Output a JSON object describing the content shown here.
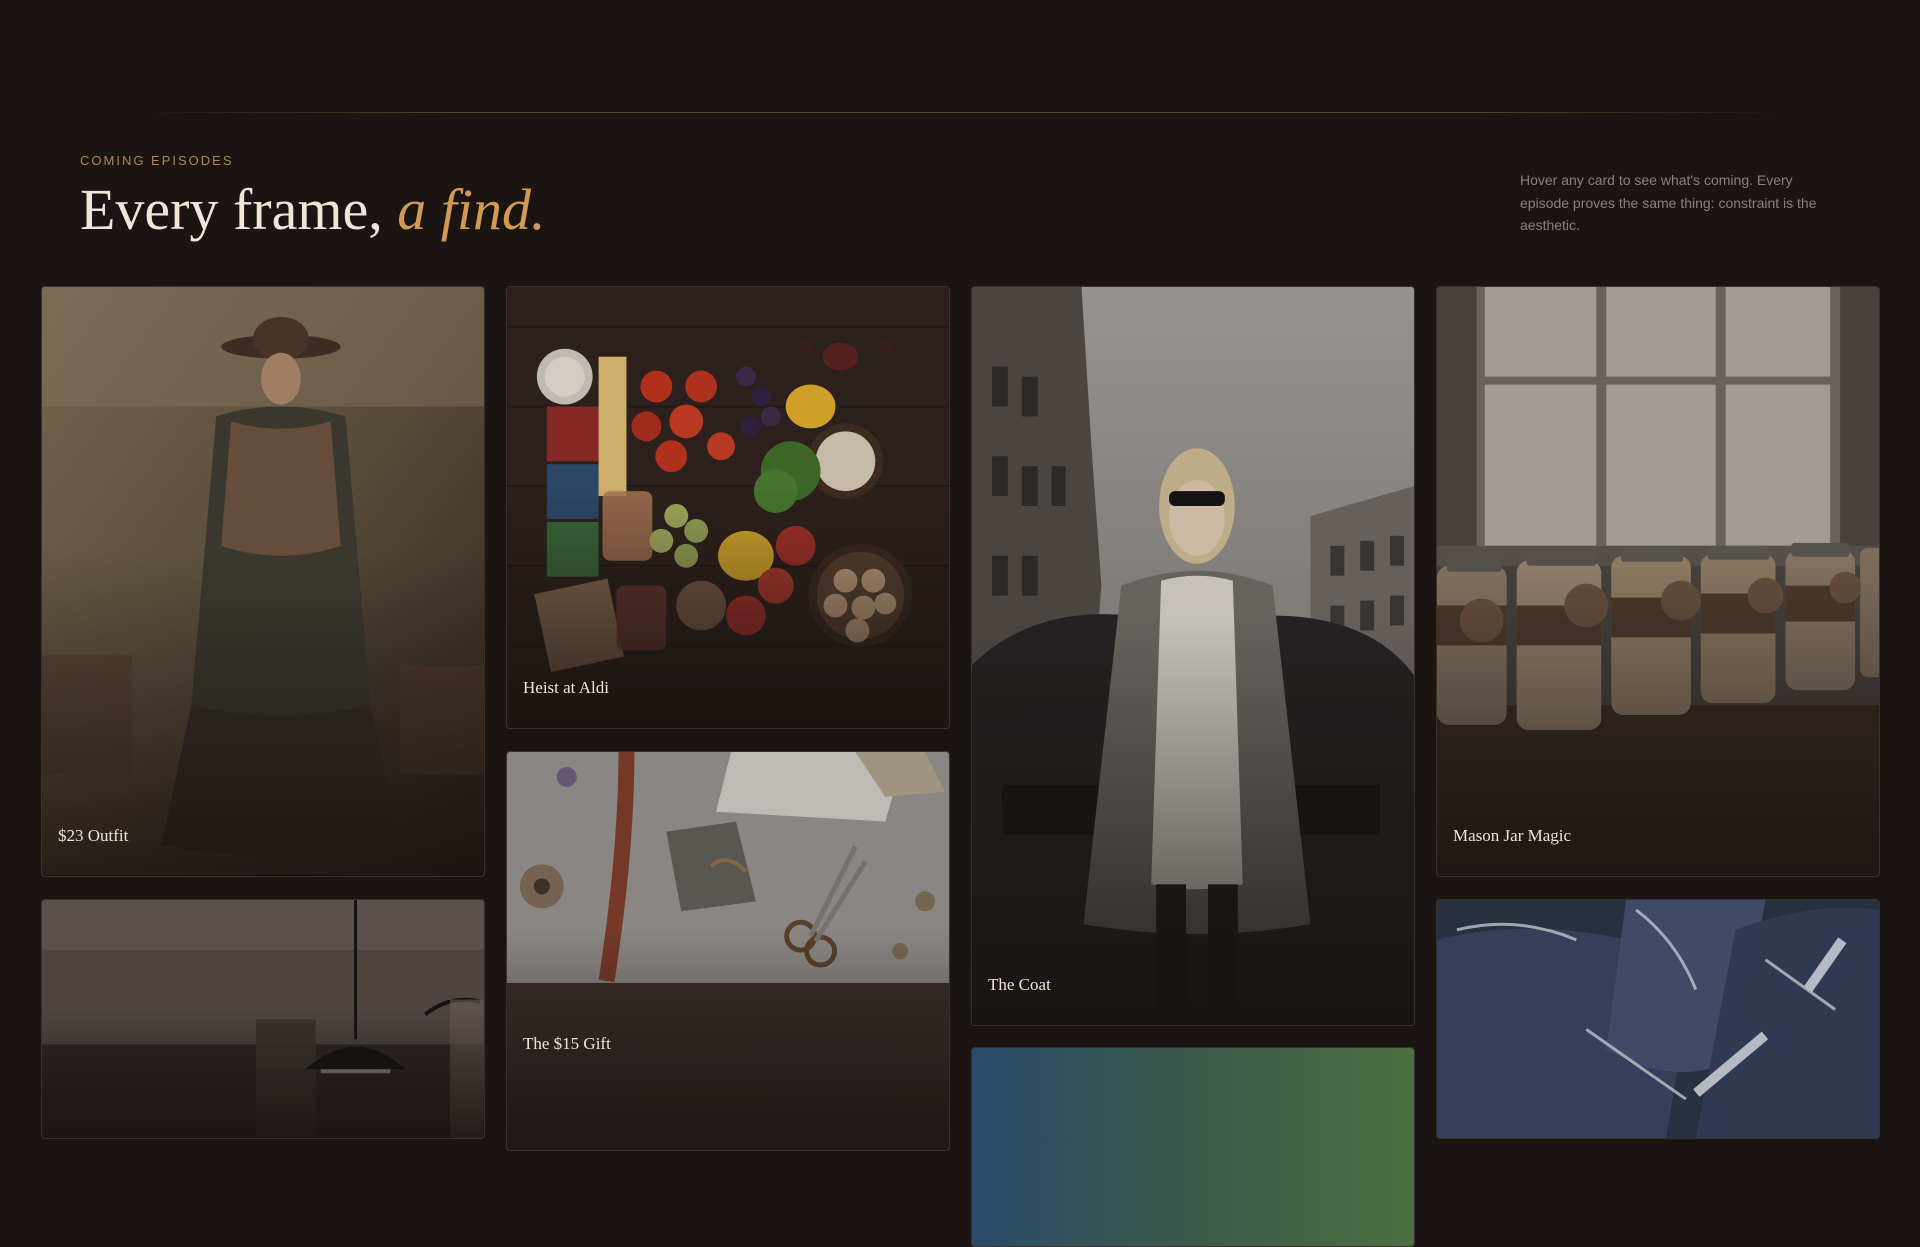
{
  "section": {
    "eyebrow": "COMING EPISODES",
    "headline_main": "Every frame, ",
    "headline_accent": "a find.",
    "side_note": "Hover any card to see what's coming. Every episode proves the same thing: constraint is the aesthetic."
  },
  "cards": [
    {
      "title": "$23 Outfit"
    },
    {
      "title": "Heist at Aldi"
    },
    {
      "title": "The Coat"
    },
    {
      "title": "Mason Jar Magic"
    },
    {
      "title": "The $15 Gift"
    }
  ],
  "colors": {
    "background": "#1a1512",
    "accent": "#d29a52",
    "eyebrow": "#b08552",
    "text": "#efe6d9",
    "muted": "#8a8178"
  }
}
